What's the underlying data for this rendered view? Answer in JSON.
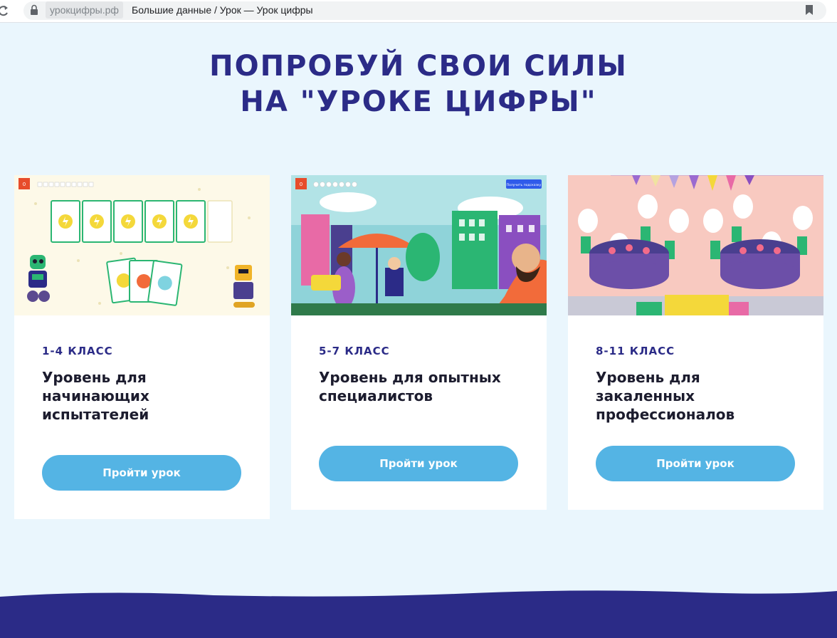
{
  "browser": {
    "domain": "урокцифры.рф",
    "title": "Большие данные / Урок — Урок цифры"
  },
  "hero": {
    "line1": "ПОПРОБУЙ СВОИ СИЛЫ",
    "line2": "НА \"УРОКЕ ЦИФРЫ\""
  },
  "cards": [
    {
      "grade": "1-4 КЛАСС",
      "title": "Уровень для начинающих испытателей",
      "button": "Пройти урок",
      "thumb_badge": "0"
    },
    {
      "grade": "5-7 КЛАСС",
      "title": "Уровень для опытных специалистов",
      "button": "Пройти урок",
      "thumb_badge": "0",
      "thumb_button": "Получить подсказку"
    },
    {
      "grade": "8-11 КЛАСС",
      "title": "Уровень для закаленных профессионалов",
      "button": "Пройти урок"
    }
  ],
  "colors": {
    "page_bg": "#eaf6fd",
    "heading": "#2b2b87",
    "button": "#54b4e4",
    "footer": "#2b2b87"
  },
  "icons": [
    "reload-icon",
    "lock-icon",
    "bookmark-icon"
  ]
}
